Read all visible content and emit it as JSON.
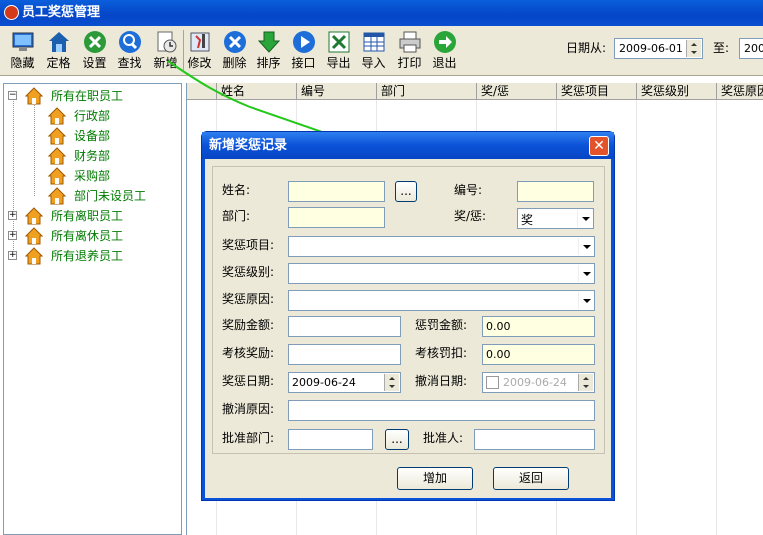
{
  "window": {
    "title": "员工奖惩管理"
  },
  "toolbar": {
    "buttons": [
      {
        "icon": "monitor-icon",
        "label": "隐藏"
      },
      {
        "icon": "house-icon",
        "label": "定格"
      },
      {
        "icon": "settings-icon",
        "label": "设置"
      },
      {
        "icon": "search-icon",
        "label": "查找"
      },
      {
        "icon": "new-record-icon",
        "label": "新增"
      },
      {
        "icon": "edit-icon",
        "label": "修改"
      },
      {
        "icon": "delete-icon",
        "label": "删除"
      },
      {
        "icon": "sort-arrow-icon",
        "label": "排序"
      },
      {
        "icon": "interface-arrow-icon",
        "label": "接口"
      },
      {
        "icon": "excel-export-icon",
        "label": "导出"
      },
      {
        "icon": "grid-import-icon",
        "label": "导入"
      },
      {
        "icon": "printer-icon",
        "label": "打印"
      },
      {
        "icon": "exit-icon",
        "label": "退出"
      }
    ],
    "date_from_label": "日期从:",
    "date_from": "2009-06-01",
    "date_to_label": "至:",
    "date_to": "2009"
  },
  "tree": {
    "nodes": [
      {
        "label": "所有在职员工",
        "expander": "−"
      },
      {
        "label": "行政部"
      },
      {
        "label": "设备部"
      },
      {
        "label": "财务部"
      },
      {
        "label": "采购部"
      },
      {
        "label": "部门未设员工"
      },
      {
        "label": "所有离职员工",
        "expander": "+"
      },
      {
        "label": "所有离休员工",
        "expander": "+"
      },
      {
        "label": "所有退养员工",
        "expander": "+"
      }
    ]
  },
  "grid": {
    "columns": [
      "姓名",
      "编号",
      "部门",
      "奖/惩",
      "奖惩项目",
      "奖惩级别",
      "奖惩原因"
    ]
  },
  "dialog": {
    "title": "新增奖惩记录",
    "close": "✕",
    "name_label": "姓名:",
    "name_value": "",
    "browse1": "...",
    "code_label": "编号:",
    "code_value": "",
    "dept_label": "部门:",
    "dept_value": "",
    "type_label": "奖/惩:",
    "type_value": "奖",
    "item_label": "奖惩项目:",
    "level_label": "奖惩级别:",
    "reason_label": "奖惩原因:",
    "reward_amount_label": "奖励金额:",
    "penalty_amount_label": "惩罚金额:",
    "penalty_amount": "0.00",
    "assess_reward_label": "考核奖励:",
    "assess_penalty_label": "考核罚扣:",
    "assess_penalty": "0.00",
    "date_label": "奖惩日期:",
    "date_value": "2009-06-24",
    "cancel_date_label": "撤消日期:",
    "cancel_date_value": "2009-06-24",
    "cancel_reason_label": "撤消原因:",
    "approve_dept_label": "批准部门:",
    "browse2": "...",
    "approver_label": "批准人:",
    "add_button": "增加",
    "back_button": "返回"
  }
}
